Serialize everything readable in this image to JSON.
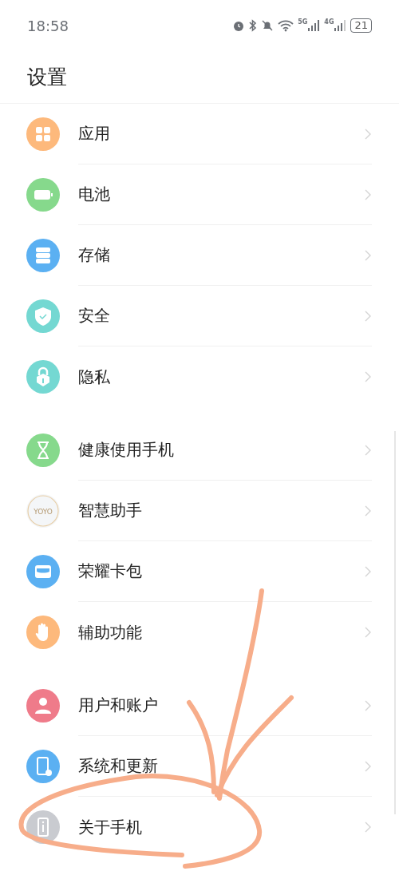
{
  "status_bar": {
    "time": "18:58",
    "network_1": "5G",
    "network_2": "4G",
    "battery": "21"
  },
  "title": "设置",
  "groups": [
    {
      "items": [
        {
          "label": "应用",
          "kind": "apps",
          "color": "#fdb97c"
        },
        {
          "label": "电池",
          "kind": "battery",
          "color": "#86d98c"
        },
        {
          "label": "存储",
          "kind": "storage",
          "color": "#5bb0f2"
        },
        {
          "label": "安全",
          "kind": "shield",
          "color": "#74d8d2"
        },
        {
          "label": "隐私",
          "kind": "lock",
          "color": "#74d8d2"
        }
      ]
    },
    {
      "items": [
        {
          "label": "健康使用手机",
          "kind": "hourglass",
          "color": "#86d98c"
        },
        {
          "label": "智慧助手",
          "kind": "assistant",
          "icon_text": "YOYO",
          "color": "#f4f6f8"
        },
        {
          "label": "荣耀卡包",
          "kind": "wallet",
          "color": "#5bb0f2"
        },
        {
          "label": "辅助功能",
          "kind": "hand",
          "color": "#fdb97c"
        }
      ]
    },
    {
      "items": [
        {
          "label": "用户和账户",
          "kind": "user",
          "color": "#ef7b8a"
        },
        {
          "label": "系统和更新",
          "kind": "system",
          "color": "#5bb0f2"
        },
        {
          "label": "关于手机",
          "kind": "info",
          "color": "#c9cbd0"
        }
      ]
    }
  ]
}
